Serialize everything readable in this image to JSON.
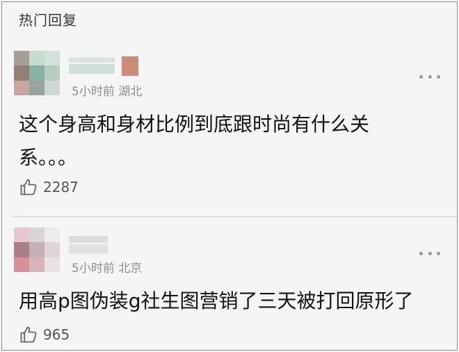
{
  "section_title": "热门回复",
  "comments": [
    {
      "meta": "5小时前 湖北",
      "content": "这个身高和身材比例到底跟时尚有什么关系。。。",
      "likes": "2287",
      "avatar_colors": [
        "#a69c98",
        "#c6dccf",
        "#d4e3da",
        "#967e78",
        "#8ab1a1",
        "#b6ccc1",
        "#c6a7a4",
        "#9aa49e",
        "#cfd9d3"
      ],
      "more_icon": "more-dots-icon",
      "like_icon": "thumbs-up-icon"
    },
    {
      "meta": "5小时前 北京",
      "content": "用高p图伪装g社生图营销了三天被打回原形了",
      "likes": "965",
      "avatar_colors": [
        "#e7c7cd",
        "#d9d4d6",
        "#ececec",
        "#a98087",
        "#c7b0b5",
        "#e0d4d7",
        "#d59098",
        "#d9b3ba",
        "#e8e2e3"
      ],
      "more_icon": "more-dots-icon",
      "like_icon": "thumbs-up-icon"
    }
  ]
}
